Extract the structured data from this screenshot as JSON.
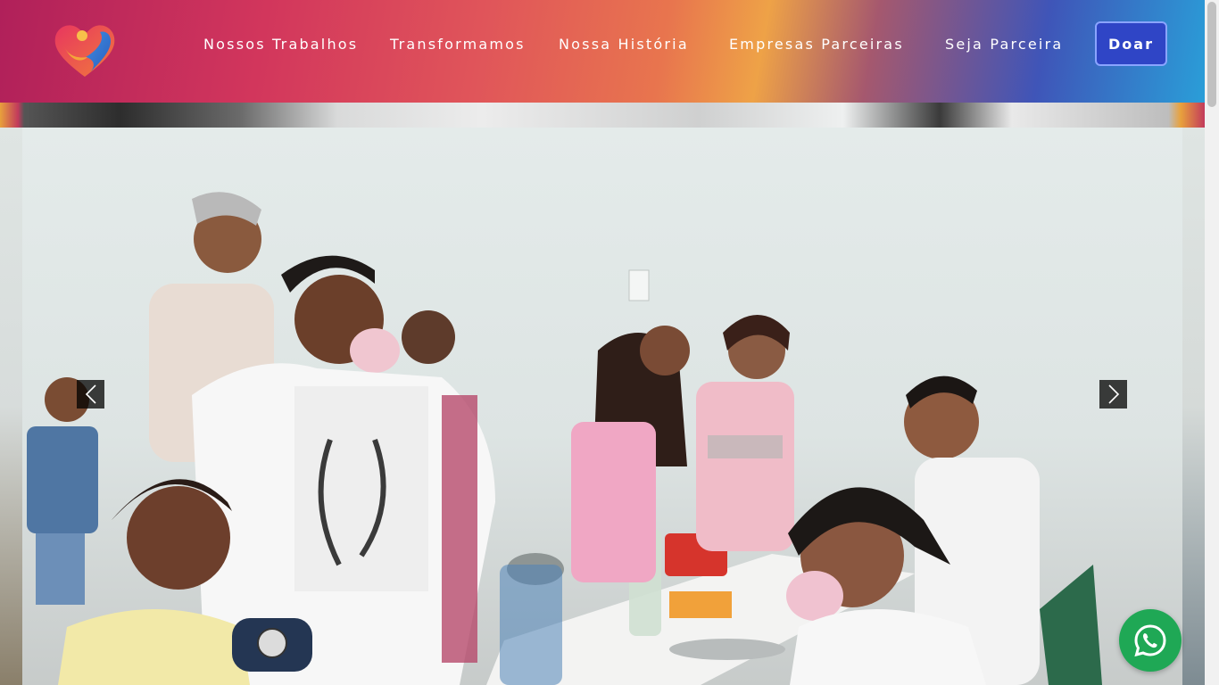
{
  "nav": {
    "items": [
      {
        "label": "Nossos Trabalhos"
      },
      {
        "label": "Transformamos"
      },
      {
        "label": "Nossa História"
      },
      {
        "label": "Empresas Parceiras"
      },
      {
        "label": "Seja Parceira"
      }
    ],
    "donate_label": "Doar"
  },
  "icons": {
    "logo": "heart-hands-logo",
    "prev": "chevron-left-icon",
    "next": "chevron-right-icon",
    "whatsapp": "whatsapp-icon"
  },
  "colors": {
    "donate_button": "#2f45c6",
    "whatsapp": "#1fa855"
  }
}
